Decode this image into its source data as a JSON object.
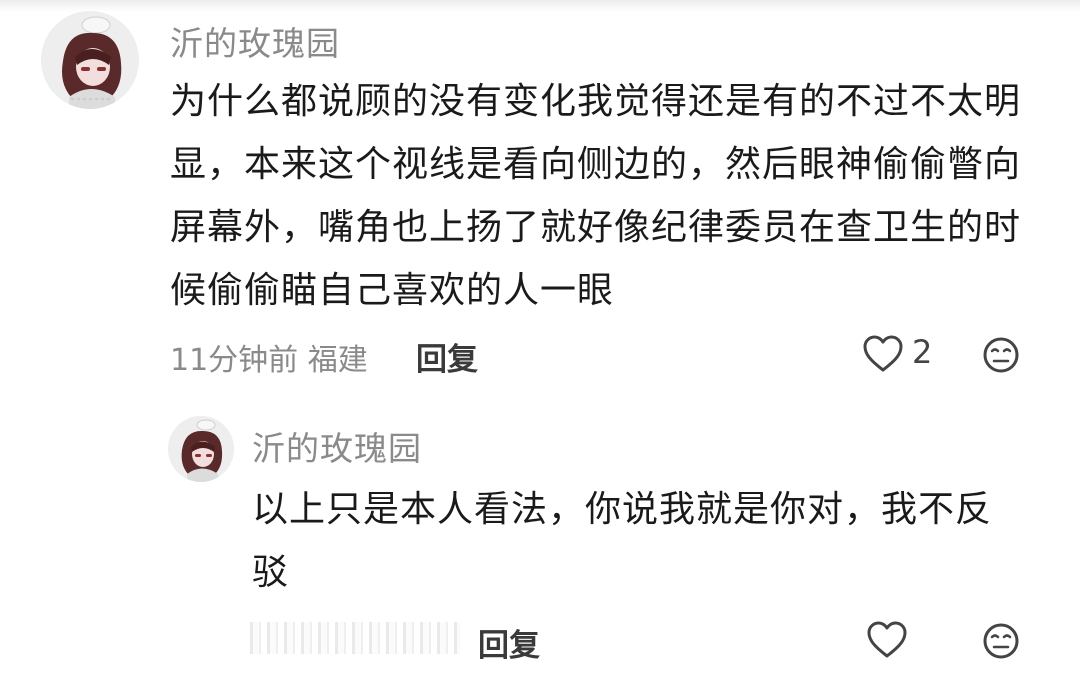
{
  "comments": [
    {
      "username": "沂的玫瑰园",
      "text": "为什么都说顾的没有变化我觉得还是有的不过不太明显，本来这个视线是看向侧边的，然后眼神偷偷瞥向屏幕外，嘴角也上扬了就好像纪律委员在查卫生的时候偷偷瞄自己喜欢的人一眼",
      "meta": "11分钟前 福建",
      "reply_label": "回复",
      "likes": "2",
      "icons": {
        "like": "heart-outline-icon",
        "dislike": "neutral-face-icon"
      }
    },
    {
      "username": "沂的玫瑰园",
      "text": "以上只是本人看法，你说我就是你对，我不反驳",
      "reply_label": "回复",
      "icons": {
        "like": "heart-outline-icon",
        "dislike": "neutral-face-icon"
      }
    }
  ],
  "colors": {
    "username": "#8a8a8a",
    "body_text": "#1a1a1a",
    "meta_text": "#8a8a8a",
    "icon_stroke": "#444444"
  }
}
